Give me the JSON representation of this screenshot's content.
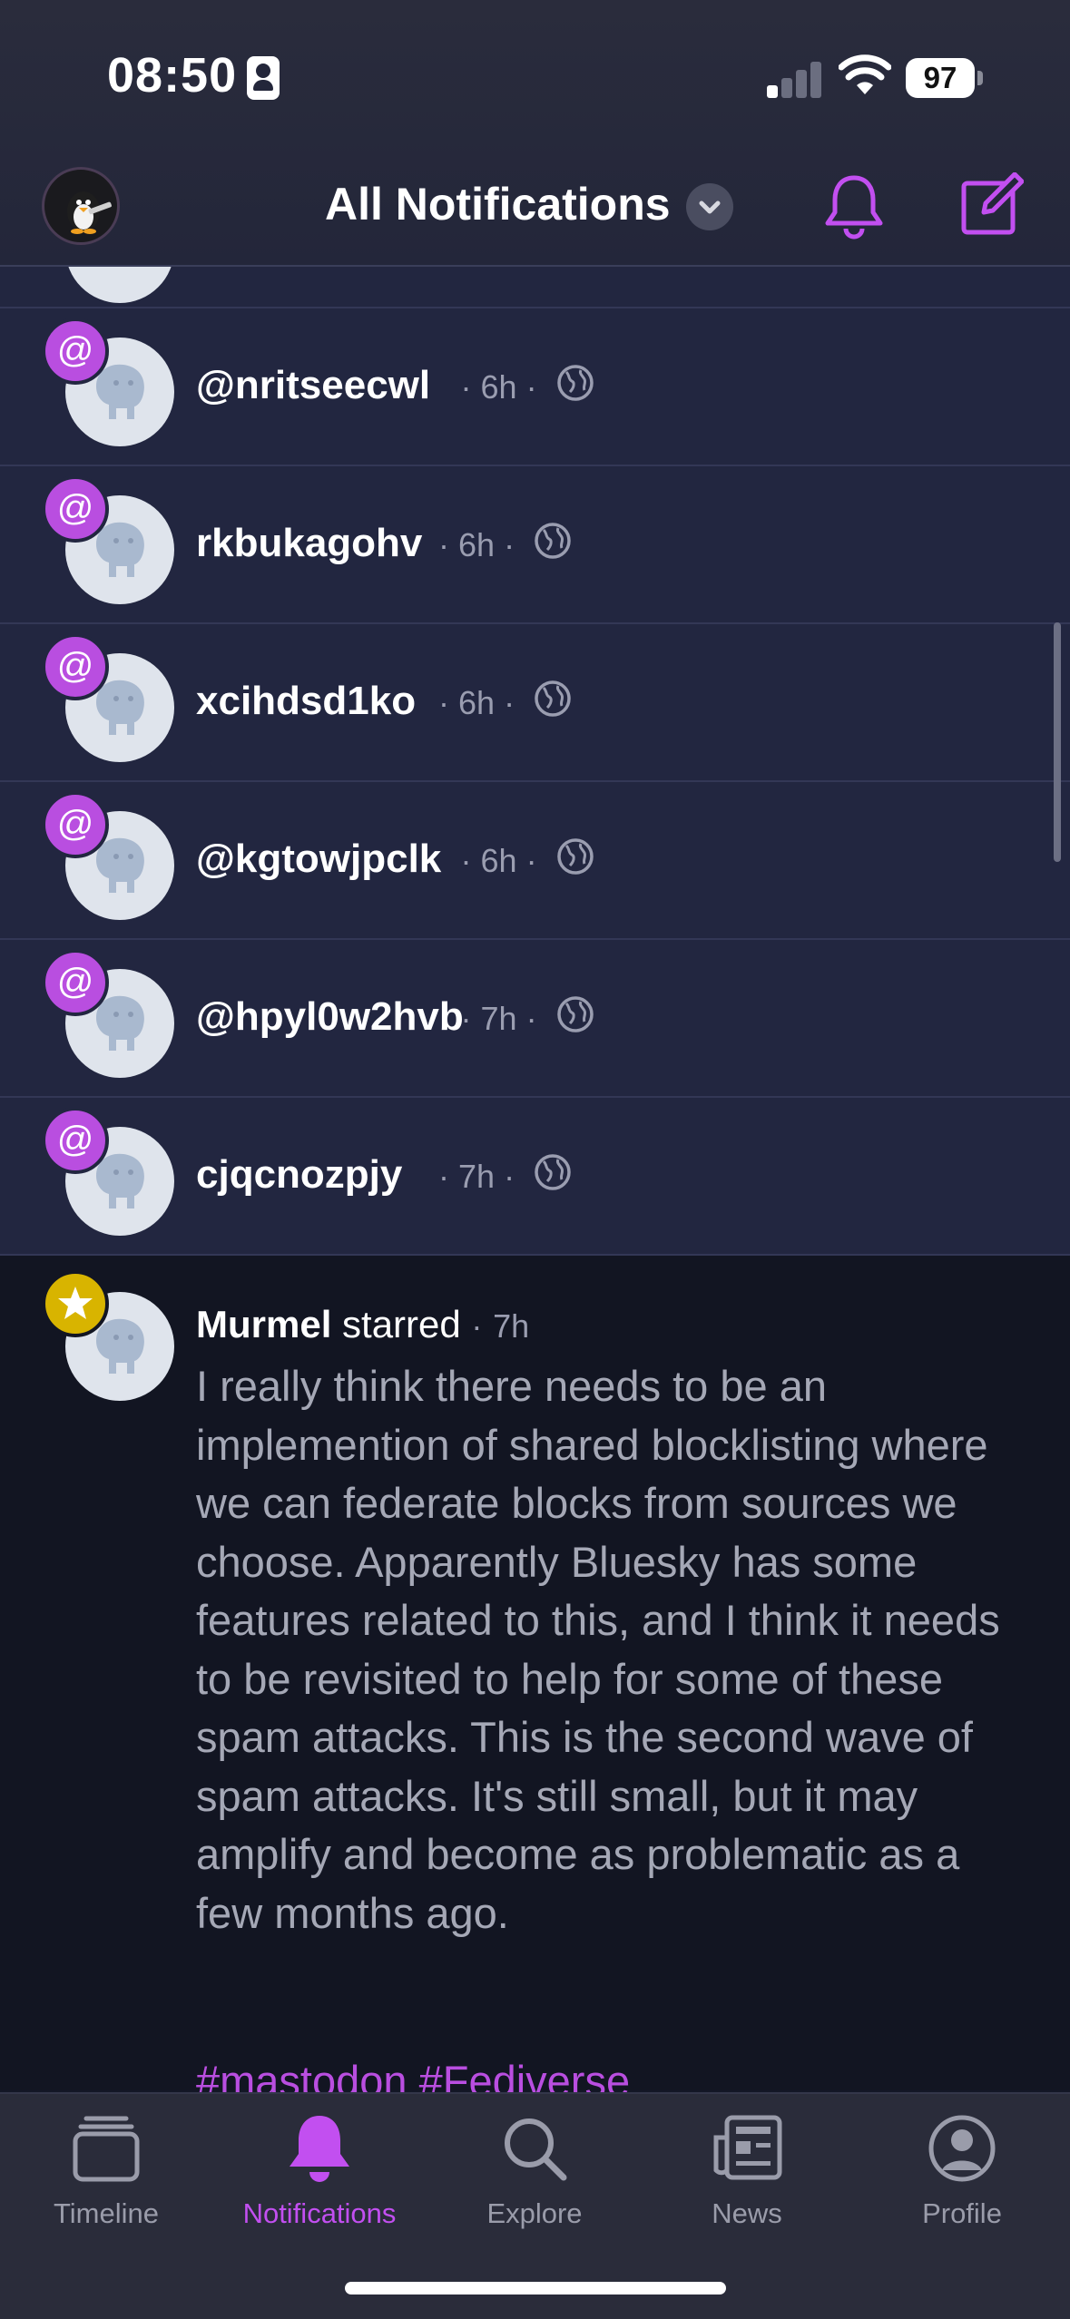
{
  "status_bar": {
    "time": "08:50",
    "battery": "97"
  },
  "header": {
    "title": "All Notifications",
    "filter_icon": "chevron-down-icon",
    "bell_icon": "bell-icon",
    "compose_icon": "compose-icon"
  },
  "colors": {
    "accent": "#c24ff0",
    "mention_row_bg": "#222640",
    "star_badge": "#d8b400",
    "page_bg": "#131726"
  },
  "notifications": [
    {
      "type": "mention",
      "name": "@nritseecwl",
      "time": "6h"
    },
    {
      "type": "mention",
      "name": "rkbukagohv",
      "time": "6h"
    },
    {
      "type": "mention",
      "name": "xcihdsd1ko",
      "time": "6h"
    },
    {
      "type": "mention",
      "name": "@kgtowjpclk",
      "time": "6h"
    },
    {
      "type": "mention",
      "name": "@hpyl0w2hvb",
      "time": "7h"
    },
    {
      "type": "mention",
      "name": "cjqcnozpjy",
      "time": "7h"
    }
  ],
  "star_notification": {
    "name": "Murmel",
    "action": "starred",
    "time": "7h",
    "body": "I really think there needs to be an implemention of shared blocklisting where we can federate blocks from sources we choose. Apparently Bluesky has some features related to this, and I think it needs to be revisited to help for some of these spam attacks. This is the second wave of spam attacks. It's still small, but it may amplify and become as problematic as a few months ago.",
    "hashtags": "#mastodon #Fediverse"
  },
  "meta_separator": "·",
  "tabs": [
    {
      "label": "Timeline",
      "icon": "timeline-icon"
    },
    {
      "label": "Notifications",
      "icon": "bell-icon",
      "active": true
    },
    {
      "label": "Explore",
      "icon": "search-icon"
    },
    {
      "label": "News",
      "icon": "newspaper-icon"
    },
    {
      "label": "Profile",
      "icon": "person-circle-icon"
    }
  ]
}
